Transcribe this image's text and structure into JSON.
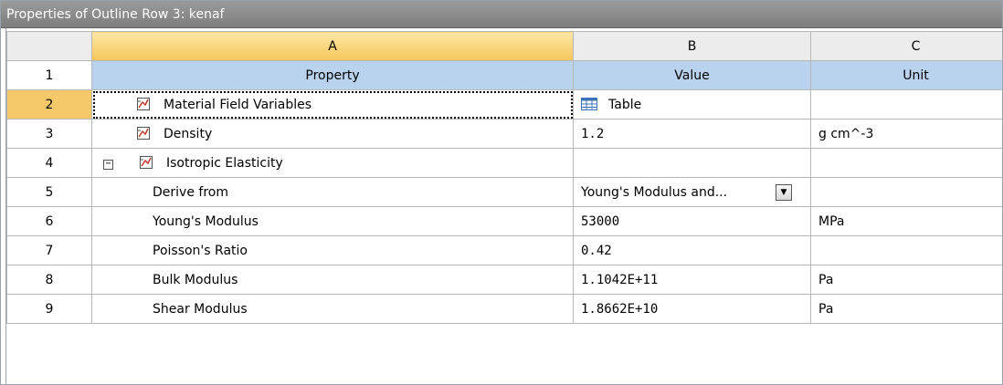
{
  "panel": {
    "title": "Properties of Outline Row 3: kenaf"
  },
  "columns": {
    "a": "A",
    "b": "B",
    "c": "C"
  },
  "header_row": {
    "num": "1",
    "property": "Property",
    "value": "Value",
    "unit": "Unit"
  },
  "rows": [
    {
      "num": "2",
      "property": "Material Field Variables",
      "value": "Table",
      "unit": ""
    },
    {
      "num": "3",
      "property": "Density",
      "value": "1.2",
      "unit": "g cm^-3"
    },
    {
      "num": "4",
      "property": "Isotropic Elasticity",
      "value": "",
      "unit": "",
      "collapse": "−"
    },
    {
      "num": "5",
      "property": "Derive from",
      "value": "Young's Modulus and...",
      "unit": ""
    },
    {
      "num": "6",
      "property": "Young's Modulus",
      "value": "53000",
      "unit": "MPa"
    },
    {
      "num": "7",
      "property": "Poisson's Ratio",
      "value": "0.42",
      "unit": ""
    },
    {
      "num": "8",
      "property": "Bulk Modulus",
      "value": "1.1042E+11",
      "unit": "Pa"
    },
    {
      "num": "9",
      "property": "Shear Modulus",
      "value": "1.8662E+10",
      "unit": "Pa"
    }
  ],
  "icons": {
    "property_chart": "chart-icon",
    "table": "table-icon",
    "dropdown": "dropdown-arrow-icon"
  },
  "colors": {
    "header_blue": "#b9d3ee",
    "selected_row": "#f5c86a",
    "title_bar": "#888888"
  }
}
